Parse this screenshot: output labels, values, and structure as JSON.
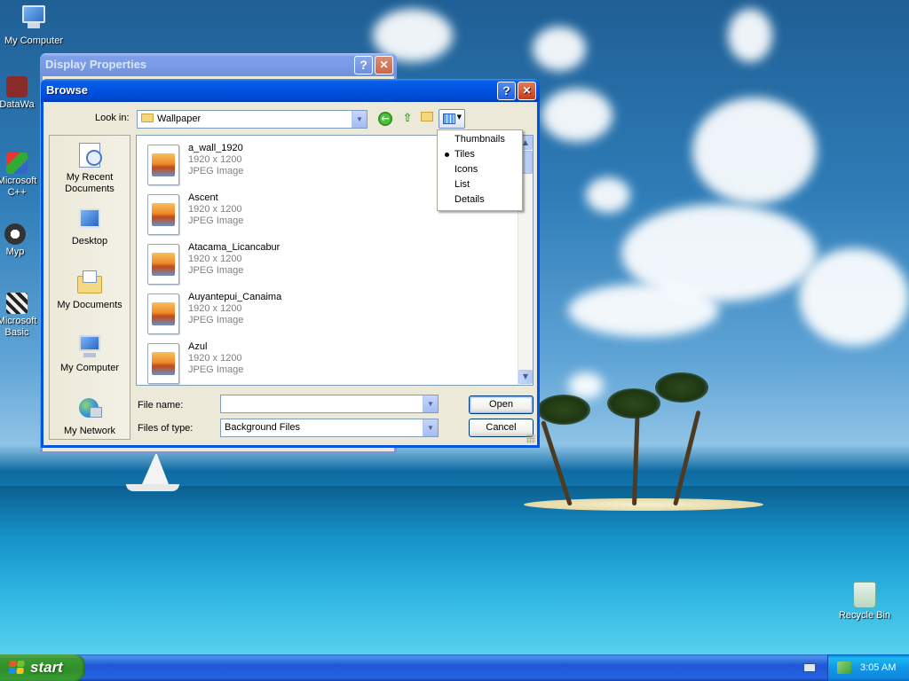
{
  "desktop": {
    "icons": [
      {
        "label": "My Computer"
      },
      {
        "label": "DataWa"
      },
      {
        "label": "Microsoft C++"
      },
      {
        "label": "Myp"
      },
      {
        "label": "Microsoft Basic"
      },
      {
        "label": "Recycle Bin"
      }
    ]
  },
  "display_properties": {
    "title": "Display Properties",
    "help_label": "?",
    "close_label": "✕"
  },
  "browse": {
    "title": "Browse",
    "help_label": "?",
    "close_label": "✕",
    "look_in_label": "Look in:",
    "look_in_value": "Wallpaper",
    "places": [
      {
        "label": "My Recent Documents"
      },
      {
        "label": "Desktop"
      },
      {
        "label": "My Documents"
      },
      {
        "label": "My Computer"
      },
      {
        "label": "My Network"
      }
    ],
    "files": [
      {
        "name": "a_wall_1920",
        "dimensions": "1920 x 1200",
        "type": "JPEG Image"
      },
      {
        "name": "Ascent",
        "dimensions": "1920 x 1200",
        "type": "JPEG Image"
      },
      {
        "name": "Atacama_Licancabur",
        "dimensions": "1920 x 1200",
        "type": "JPEG Image"
      },
      {
        "name": "Auyantepui_Canaima",
        "dimensions": "1920 x 1200",
        "type": "JPEG Image"
      },
      {
        "name": "Azul",
        "dimensions": "1920 x 1200",
        "type": "JPEG Image"
      }
    ],
    "file_name_label": "File name:",
    "file_name_value": "",
    "files_of_type_label": "Files of type:",
    "files_of_type_value": "Background Files",
    "open_label": "Open",
    "cancel_label": "Cancel"
  },
  "view_menu": {
    "items": [
      "Thumbnails",
      "Tiles",
      "Icons",
      "List",
      "Details"
    ],
    "selected": "Tiles"
  },
  "taskbar": {
    "start_label": "start",
    "clock": "3:05 AM"
  },
  "colors": {
    "title_active": "#0053e1",
    "start_green": "#3c9a34",
    "tray_blue": "#1396e8"
  }
}
